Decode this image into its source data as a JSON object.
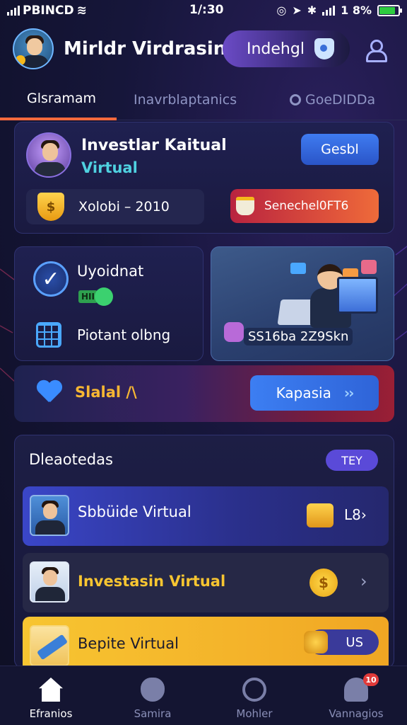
{
  "status_bar": {
    "carrier": "PBINCD",
    "time": "1/:30",
    "battery": "1 8%",
    "battery_level_pct": 86
  },
  "header": {
    "title": "Mirldr Virdrasin",
    "pill_label": "Indehgl"
  },
  "tabs": [
    {
      "label": "Glsramam",
      "active": true
    },
    {
      "label": "Inavrblaptanics",
      "active": false
    },
    {
      "label": "GoeDIDDa",
      "active": false
    }
  ],
  "profile": {
    "name": "Investlar Kaitual",
    "subtitle": "Virtual",
    "action_label": "Gesbl",
    "shield_symbol": "$",
    "balance_text": "Xolobi – 2010",
    "promo_label": "Senechel0FT6"
  },
  "features": {
    "title": "Uyoidnat",
    "toggle_label": "HII",
    "body_label": "Piotant olbng",
    "promo_text": "SS16ba 2Z9Skn"
  },
  "banner": {
    "label": "Slalal /\\",
    "button_label": "Kapasia",
    "button_chevrons": "››"
  },
  "list": {
    "title": "Dleaotedas",
    "badge": "TEY",
    "rows": [
      {
        "label": "Sbbüide Virtual",
        "meta": "L8›"
      },
      {
        "label": "Investasin Virtual",
        "coin": "$",
        "arrow": "›"
      },
      {
        "label": "Bepite Virtual",
        "pill": "US"
      }
    ]
  },
  "bottom_nav": [
    {
      "label": "Efranios",
      "active": true
    },
    {
      "label": "Samira",
      "active": false
    },
    {
      "label": "Mohler",
      "active": false
    },
    {
      "label": "Vannagios",
      "active": false,
      "badge": "10"
    }
  ],
  "colors": {
    "accent": "#ff6a3d",
    "primary_blue": "#3c7ef2",
    "gold": "#f7c531",
    "cyan": "#4fd1e0"
  }
}
